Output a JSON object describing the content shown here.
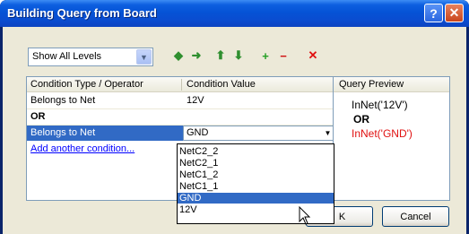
{
  "window": {
    "title": "Building Query from Board",
    "help_label": "?",
    "close_label": "✕"
  },
  "toolbar": {
    "levels_value": "Show All Levels",
    "tools": [
      {
        "name": "move-left-icon",
        "glyph": "◆",
        "color": "#2f8f2f"
      },
      {
        "name": "move-right-icon",
        "glyph": "➜",
        "color": "#2f8f2f"
      },
      {
        "name": "move-up-icon",
        "glyph": "⬆",
        "color": "#2f8f2f"
      },
      {
        "name": "move-down-icon",
        "glyph": "⬇",
        "color": "#2f8f2f"
      },
      {
        "name": "add-icon",
        "glyph": "+",
        "color": "#25a025"
      },
      {
        "name": "remove-icon",
        "glyph": "−",
        "color": "#d01010"
      },
      {
        "name": "delete-icon",
        "glyph": "✕",
        "color": "#e01010"
      }
    ]
  },
  "grid": {
    "headers": [
      "Condition Type / Operator",
      "Condition Value"
    ],
    "rows": [
      {
        "type": "Belongs to Net",
        "value": "12V"
      },
      {
        "type": "OR",
        "value": ""
      },
      {
        "type": "Belongs to Net",
        "value": "GND"
      }
    ],
    "add_link": "Add another condition...",
    "combo_arrow": "▼"
  },
  "preview": {
    "header": "Query Preview",
    "lines": [
      {
        "text": "InNet('12V')",
        "color": "#000000",
        "bold": false
      },
      {
        "text": "OR",
        "color": "#000000",
        "bold": true
      },
      {
        "text": "InNet('GND')",
        "color": "#e01010",
        "bold": false
      }
    ]
  },
  "dropdown": {
    "options": [
      "NetC2_2",
      "NetC2_1",
      "NetC1_2",
      "NetC1_1",
      "GND",
      "12V"
    ],
    "selected": "GND"
  },
  "buttons": {
    "ok_label": "OK",
    "cancel_label": "Cancel",
    "ok_visible_text": "K"
  }
}
